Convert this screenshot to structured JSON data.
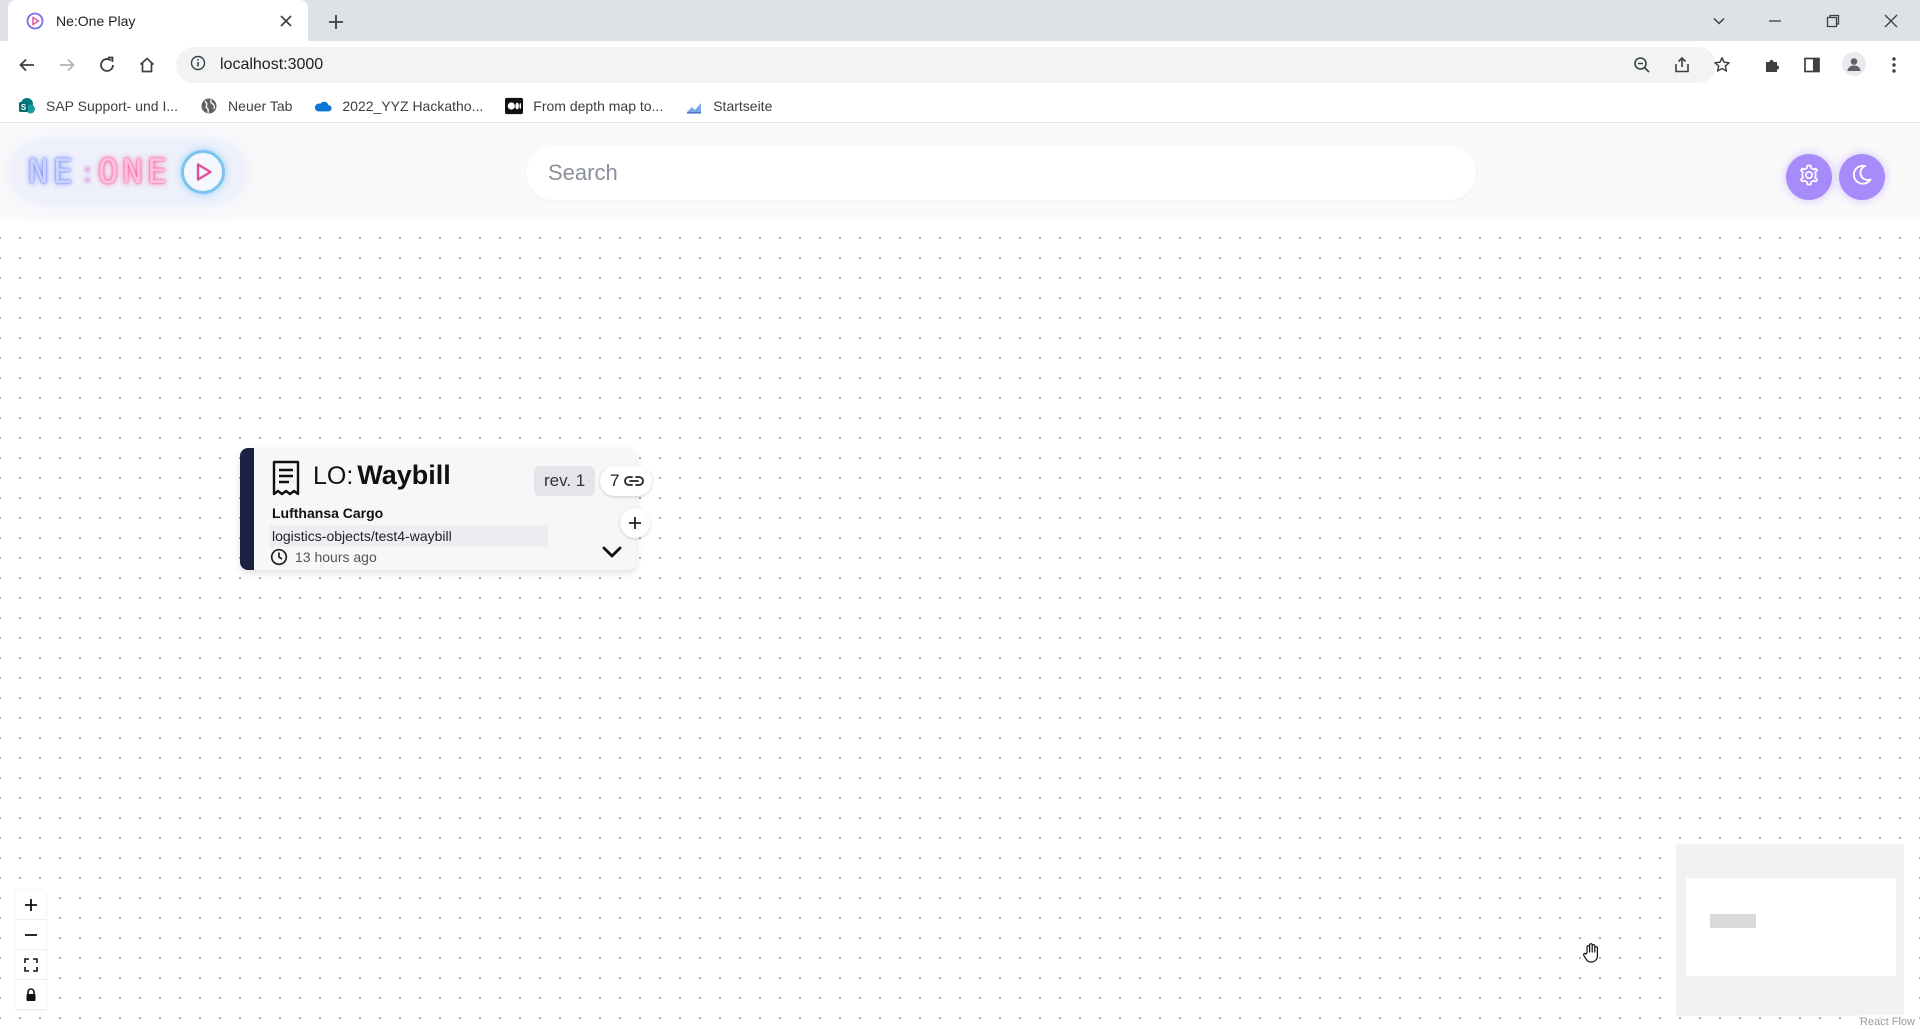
{
  "browser": {
    "tab_title": "Ne:One Play",
    "url": "localhost:3000",
    "bookmarks": [
      {
        "label": "SAP Support- und I..."
      },
      {
        "label": "Neuer Tab"
      },
      {
        "label": "2022_YYZ Hackatho..."
      },
      {
        "label": "From depth map to..."
      },
      {
        "label": "Startseite"
      }
    ]
  },
  "header": {
    "logo_ne": "NE",
    "logo_colon": ":",
    "logo_one": "ONE",
    "search_placeholder": "Search"
  },
  "node": {
    "prefix": "LO:",
    "title": "Waybill",
    "revision": "rev. 1",
    "link_count": "7",
    "organization": "Lufthansa Cargo",
    "path": "logistics-objects/test4-waybill",
    "time": "13 hours ago",
    "accent_color": "#1b2140"
  },
  "flow": {
    "attribution": "React Flow"
  },
  "colors": {
    "accent": "#a78bfa"
  }
}
